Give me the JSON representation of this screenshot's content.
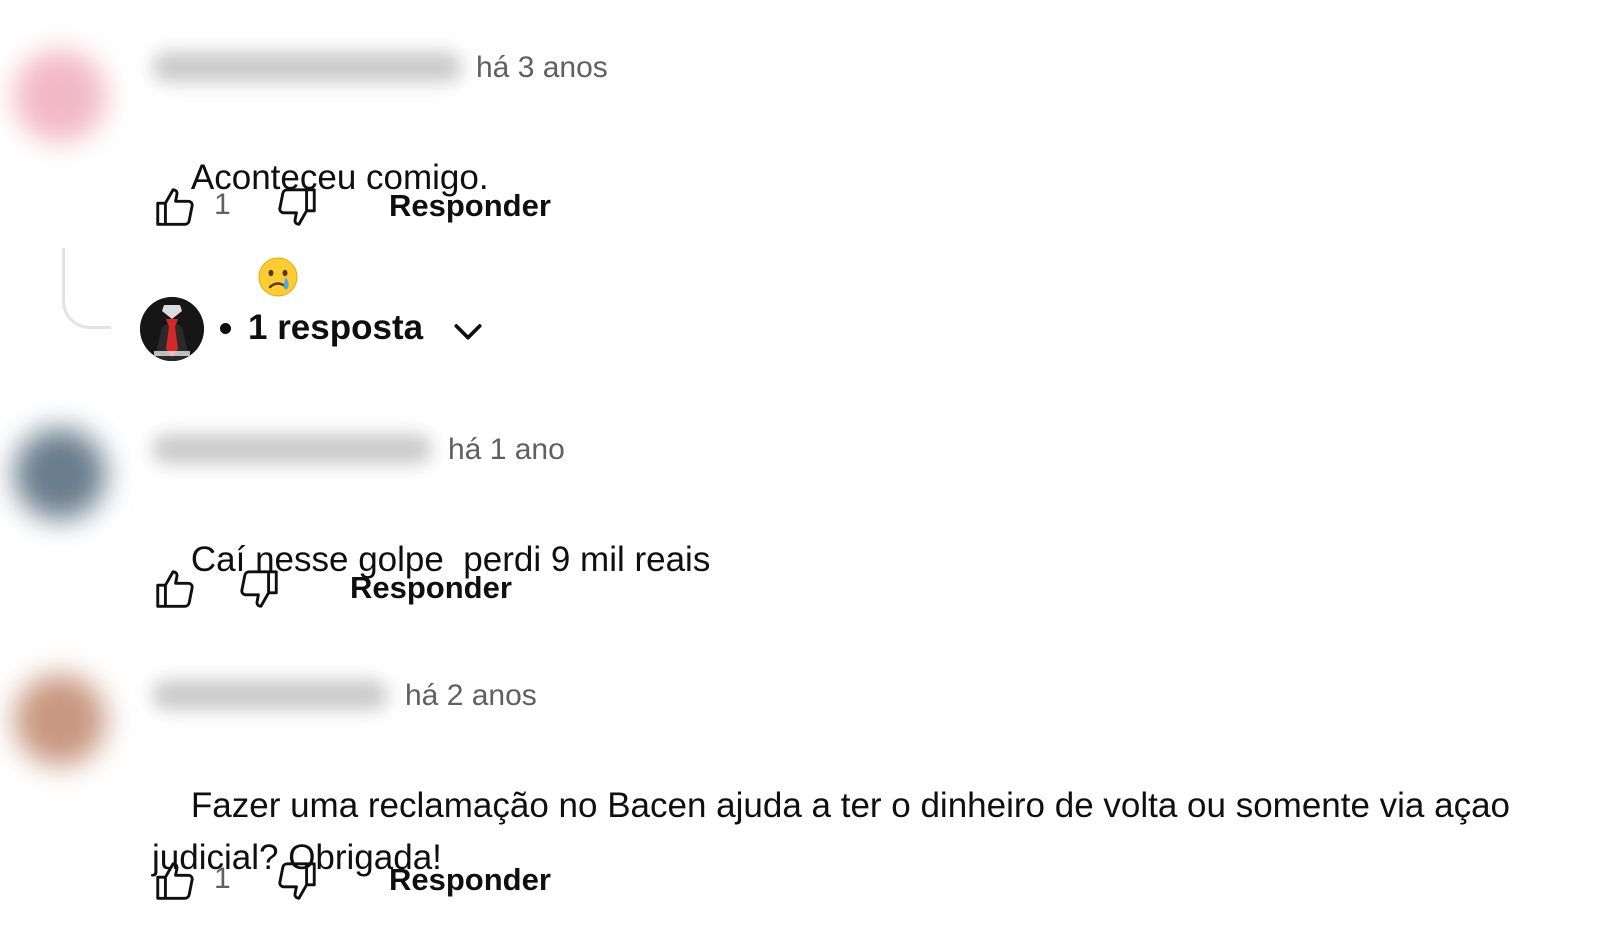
{
  "comments": [
    {
      "time": "há 3 anos",
      "text": "Aconteceu comigo.",
      "emoji": "😢",
      "emoji_name": "crying-face-icon",
      "likes": "1",
      "reply_label": "Responder",
      "avatar_color": "#f2b8c6"
    },
    {
      "time": "há 1 ano",
      "text": "Caí nesse golpe  perdi 9 mil reais",
      "likes": "",
      "reply_label": "Responder",
      "avatar_color": "#6a7d8c"
    },
    {
      "time": "há 2 anos",
      "text": "Fazer uma reclamação no Bacen ajuda a ter o dinheiro de volta ou somente via açao judicial? Obrigada!",
      "likes": "1",
      "reply_label": "Responder",
      "avatar_color": "#c89880"
    }
  ],
  "replies_toggle": {
    "label": "1 resposta",
    "separator": "•",
    "icon": "chevron-down-icon"
  },
  "colors": {
    "text": "#0f0f0f",
    "secondary": "#606060",
    "thread_line": "#e3e3e3",
    "avatar_tie": "#d62828"
  }
}
